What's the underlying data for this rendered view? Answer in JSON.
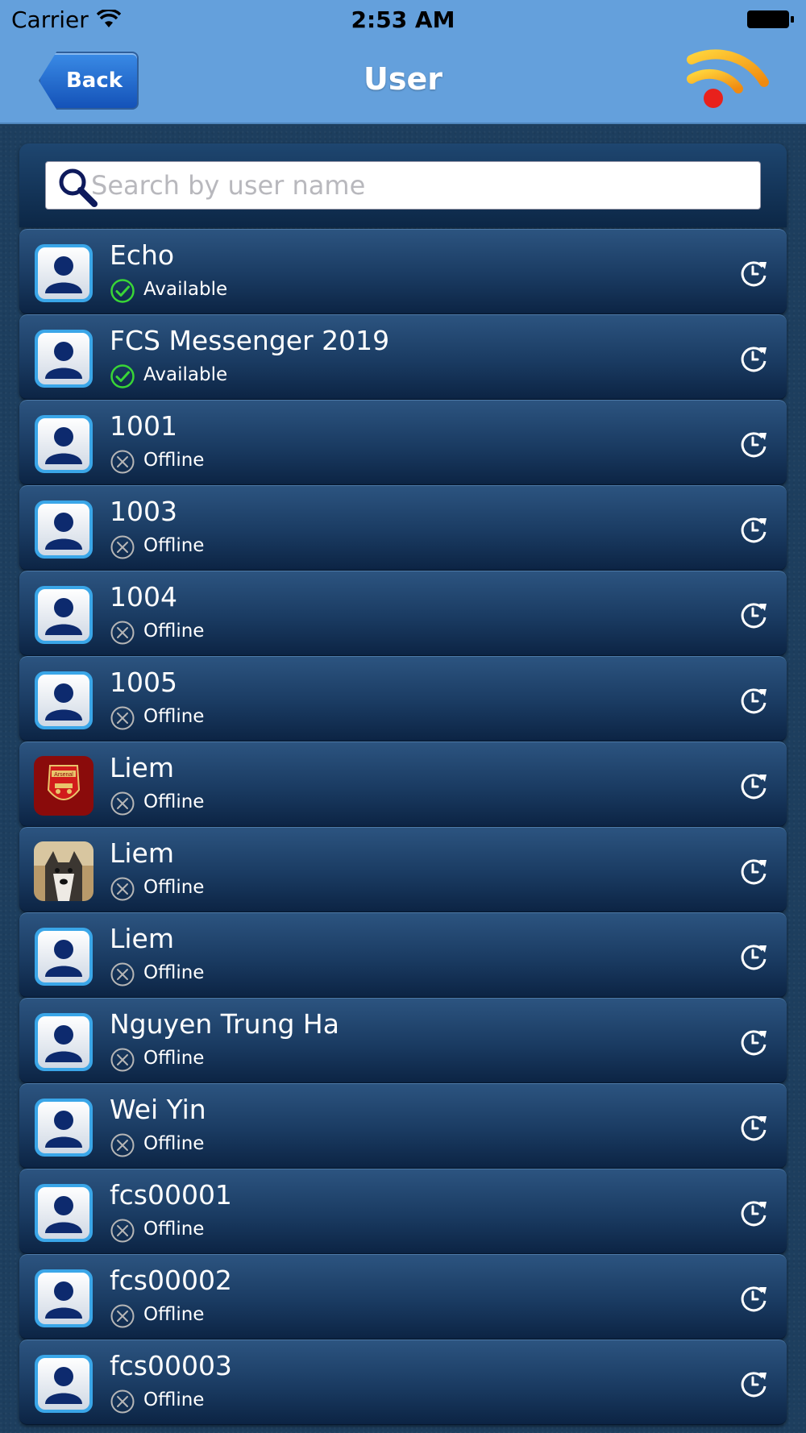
{
  "status_bar": {
    "carrier": "Carrier",
    "time": "2:53 AM"
  },
  "nav": {
    "back_label": "Back",
    "title": "User",
    "right_icon": "rss-feed-icon"
  },
  "search": {
    "placeholder": "Search by user name",
    "value": ""
  },
  "colors": {
    "nav_bar": "#64a0dc",
    "available": "#39d636",
    "offline": "#b6b6b6",
    "row_top": "#2c5480",
    "row_bottom": "#0c2444"
  },
  "users": [
    {
      "name": "Echo",
      "status": "Available",
      "avatar": "default-avatar-icon"
    },
    {
      "name": "FCS Messenger 2019",
      "status": "Available",
      "avatar": "default-avatar-icon"
    },
    {
      "name": "1001",
      "status": "Offline",
      "avatar": "default-avatar-icon"
    },
    {
      "name": "1003",
      "status": "Offline",
      "avatar": "default-avatar-icon"
    },
    {
      "name": "1004",
      "status": "Offline",
      "avatar": "default-avatar-icon"
    },
    {
      "name": "1005",
      "status": "Offline",
      "avatar": "default-avatar-icon"
    },
    {
      "name": "Liem",
      "status": "Offline",
      "avatar": "arsenal-crest-photo"
    },
    {
      "name": "Liem",
      "status": "Offline",
      "avatar": "husky-dog-photo"
    },
    {
      "name": "Liem",
      "status": "Offline",
      "avatar": "default-avatar-icon"
    },
    {
      "name": "Nguyen Trung Ha",
      "status": "Offline",
      "avatar": "default-avatar-icon"
    },
    {
      "name": "Wei Yin",
      "status": "Offline",
      "avatar": "default-avatar-icon"
    },
    {
      "name": "fcs00001",
      "status": "Offline",
      "avatar": "default-avatar-icon"
    },
    {
      "name": "fcs00002",
      "status": "Offline",
      "avatar": "default-avatar-icon"
    },
    {
      "name": "fcs00003",
      "status": "Offline",
      "avatar": "default-avatar-icon"
    }
  ],
  "avatar_photo_text": {
    "arsenal": "Arsenal"
  }
}
